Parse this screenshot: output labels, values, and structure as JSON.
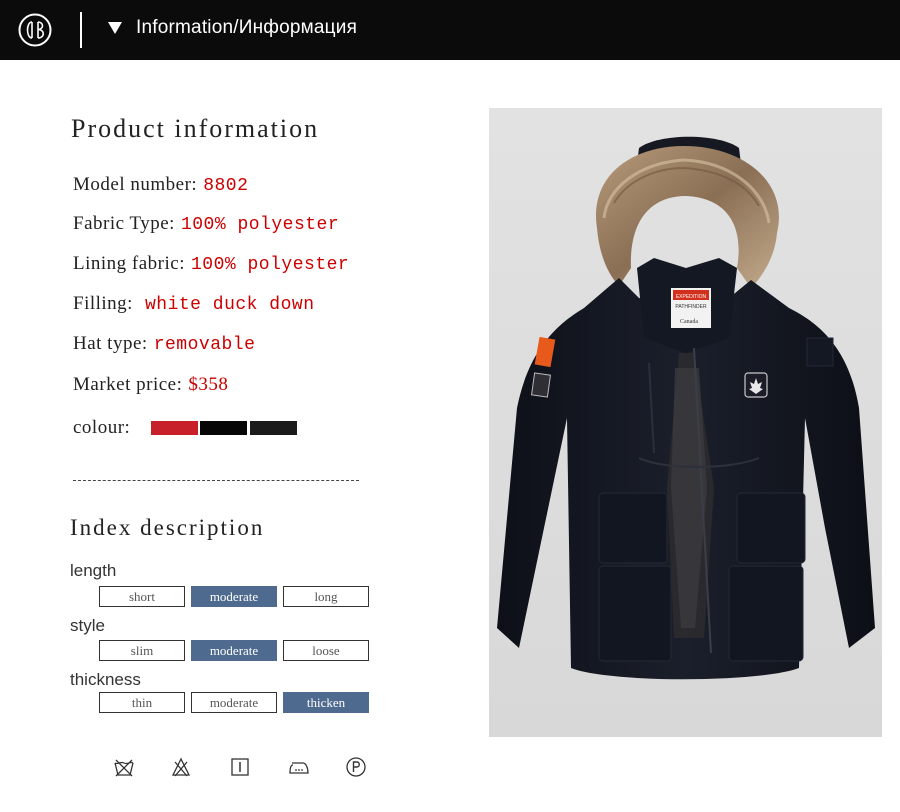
{
  "header": {
    "title": "Information/Информация",
    "logo_icon": "cb-monogram-logo",
    "arrow_icon": "triangle-down-icon"
  },
  "product_info": {
    "title": "Product information",
    "rows": [
      {
        "label": "Model number:",
        "value": "8802"
      },
      {
        "label": "Fabric Type:",
        "value": "100% polyester"
      },
      {
        "label": "Lining fabric:",
        "value": "100% polyester"
      },
      {
        "label": "Filling:",
        "value": "white duck down"
      },
      {
        "label": "Hat type:",
        "value": "removable"
      },
      {
        "label": "Market price:",
        "value": "$358"
      }
    ],
    "colour_label": "colour:",
    "colours": [
      "#c8202a",
      "#060606",
      "#1b1b1b"
    ]
  },
  "index_description": {
    "title": "Index description",
    "groups": [
      {
        "label": "length",
        "options": [
          "short",
          "moderate",
          "long"
        ],
        "selected": "moderate"
      },
      {
        "label": "style",
        "options": [
          "slim",
          "moderate",
          "loose"
        ],
        "selected": "moderate"
      },
      {
        "label": "thickness",
        "options": [
          "thin",
          "moderate",
          "thicken"
        ],
        "selected": "thicken"
      }
    ]
  },
  "care_icons": [
    "no-wash-icon",
    "no-bleach-icon",
    "tumble-dry-icon",
    "iron-icon",
    "dry-clean-p-icon"
  ],
  "product_image": {
    "subject": "black-hooded-down-parka-with-fur-trim",
    "patch_text": [
      "EXPEDITION",
      "PATHFINDER",
      "Canada"
    ]
  },
  "colors": {
    "header_bg": "#0b0b0b",
    "value_red": "#cc0000",
    "selected_option": "#4f6a8f"
  }
}
